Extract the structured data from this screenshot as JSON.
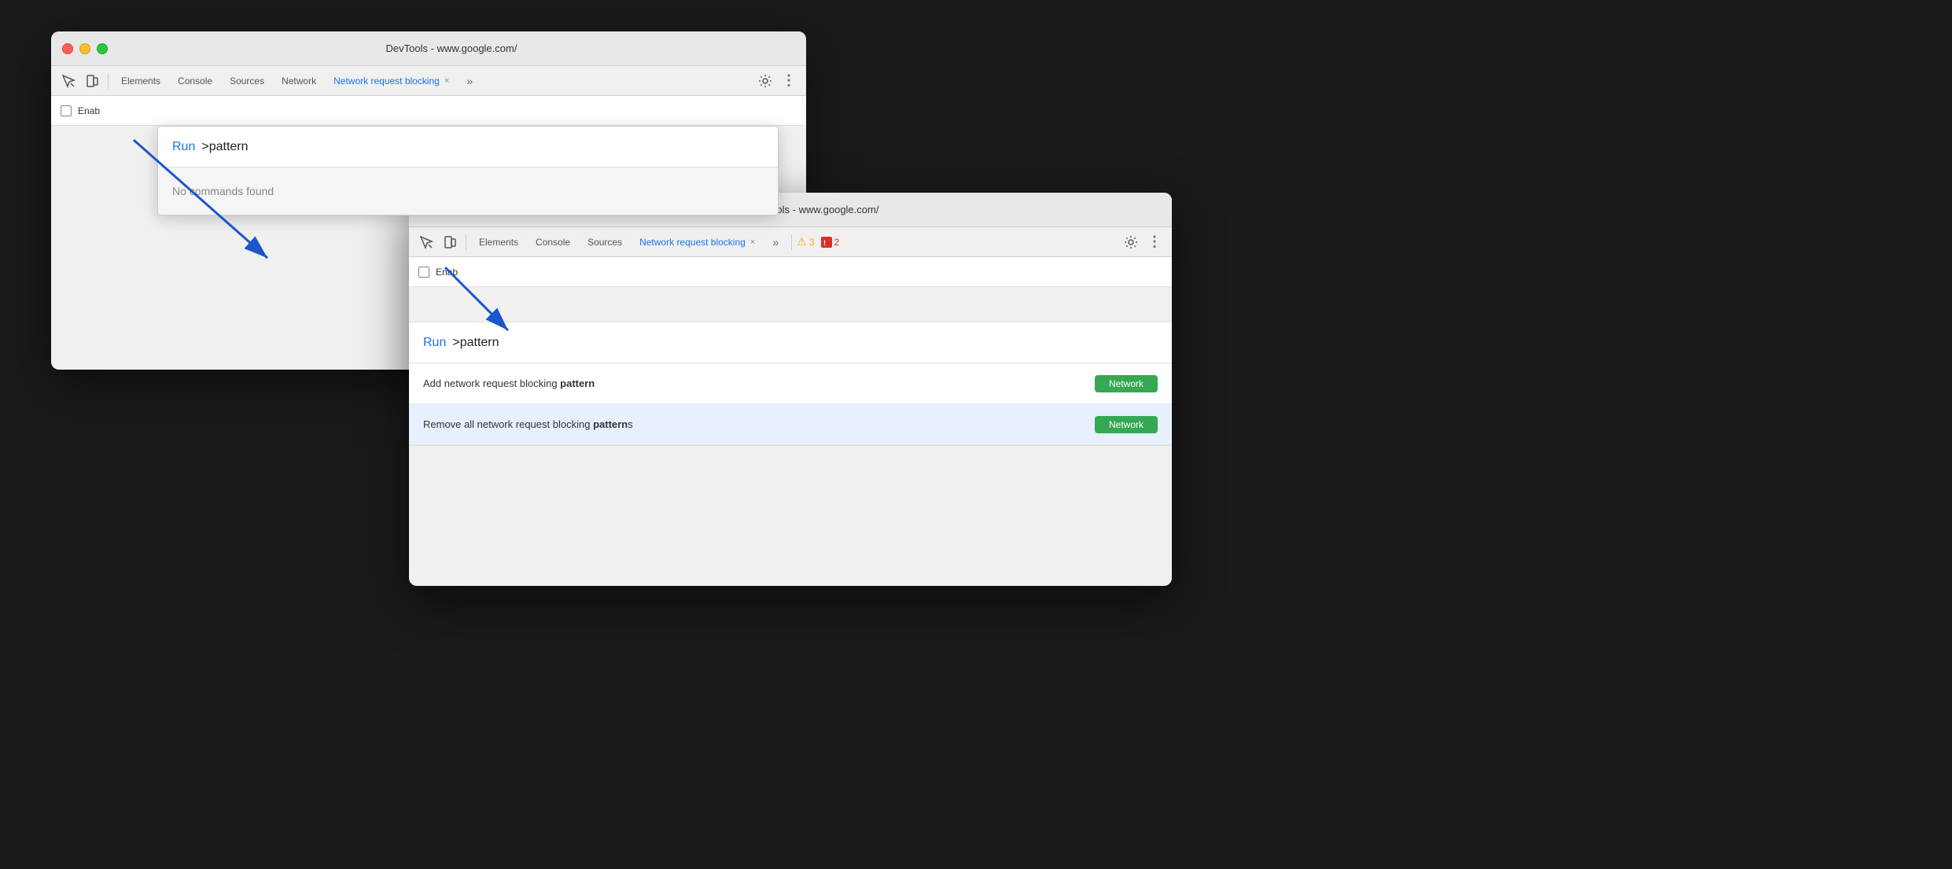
{
  "window1": {
    "title": "DevTools - www.google.com/",
    "toolbar": {
      "tabs": [
        "Elements",
        "Console",
        "Sources",
        "Network",
        "Network request blocking"
      ],
      "active_tab": "Network request blocking"
    },
    "enable_label": "Enab",
    "cmd_palette": {
      "run_label": "Run",
      "input_text": ">pattern",
      "no_results": "No commands found"
    }
  },
  "window2": {
    "title": "DevTools - www.google.com/",
    "toolbar": {
      "tabs": [
        "Elements",
        "Console",
        "Sources",
        "Network request blocking"
      ],
      "active_tab": "Network request blocking",
      "warning_count": "3",
      "error_count": "2"
    },
    "enable_label": "Enab",
    "cmd_palette": {
      "run_label": "Run",
      "input_text": ">pattern",
      "results": [
        {
          "text_before": "Add network request blocking ",
          "text_bold": "pattern",
          "text_after": "",
          "badge": "Network",
          "selected": false
        },
        {
          "text_before": "Remove all network request blocking ",
          "text_bold": "pattern",
          "text_after": "s",
          "badge": "Network",
          "selected": true
        }
      ]
    }
  },
  "icons": {
    "inspect": "⬚",
    "device": "⬜",
    "more": "»",
    "gear": "⚙",
    "menu": "⋮",
    "close": "×",
    "warning": "⚠",
    "error": "🟥"
  }
}
